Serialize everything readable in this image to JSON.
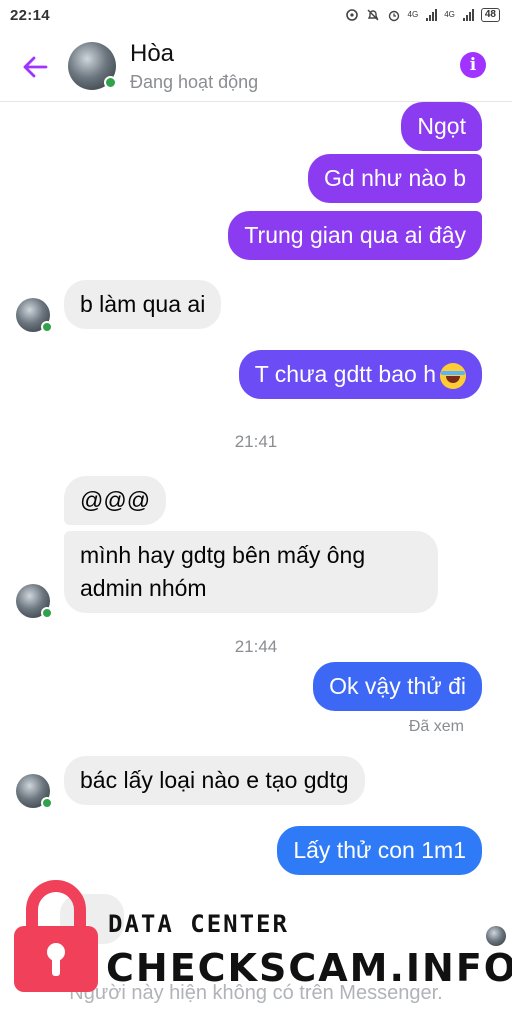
{
  "status_bar": {
    "time": "22:14",
    "network_1": "4G",
    "network_2": "4G",
    "battery": "48"
  },
  "header": {
    "contact_name": "Hòa",
    "contact_status": "Đang hoạt động",
    "icons": [
      "back-arrow-icon",
      "info-icon"
    ],
    "accent_color": "#a033ff"
  },
  "messages": [
    {
      "side": "out",
      "text": "Ngọt"
    },
    {
      "side": "out",
      "text": "Gd như nào b"
    },
    {
      "side": "out",
      "text": "Trung gian qua ai đây"
    },
    {
      "side": "in",
      "text": "b làm qua ai"
    },
    {
      "side": "out",
      "text": "T chưa gdtt bao h"
    },
    {
      "side": "in",
      "text": "@@@"
    },
    {
      "side": "in",
      "text": "mình hay gdtg bên mấy ông"
    },
    {
      "side": "in",
      "text": "admin nhóm"
    },
    {
      "side": "out",
      "text": "Ok vậy thử đi"
    },
    {
      "side": "in",
      "text": "bác lấy loại nào e tạo gdtg"
    },
    {
      "side": "out",
      "text": "Lấy thử con 1m1"
    }
  ],
  "timestamps": [
    "21:41",
    "21:44"
  ],
  "seen_label": "Đã xem",
  "footer_notice": "Người này hiện không có trên Messenger.",
  "watermark": {
    "small_text": "DATA CENTER",
    "large_text": "CHECKSCAM.INFO",
    "lock_color": "#f0405a"
  },
  "colors": {
    "bubble_purple": "#8b3cf0",
    "bubble_blue": "#2f7bf7",
    "incoming_bg": "#eeeeef",
    "online": "#31a24c"
  }
}
